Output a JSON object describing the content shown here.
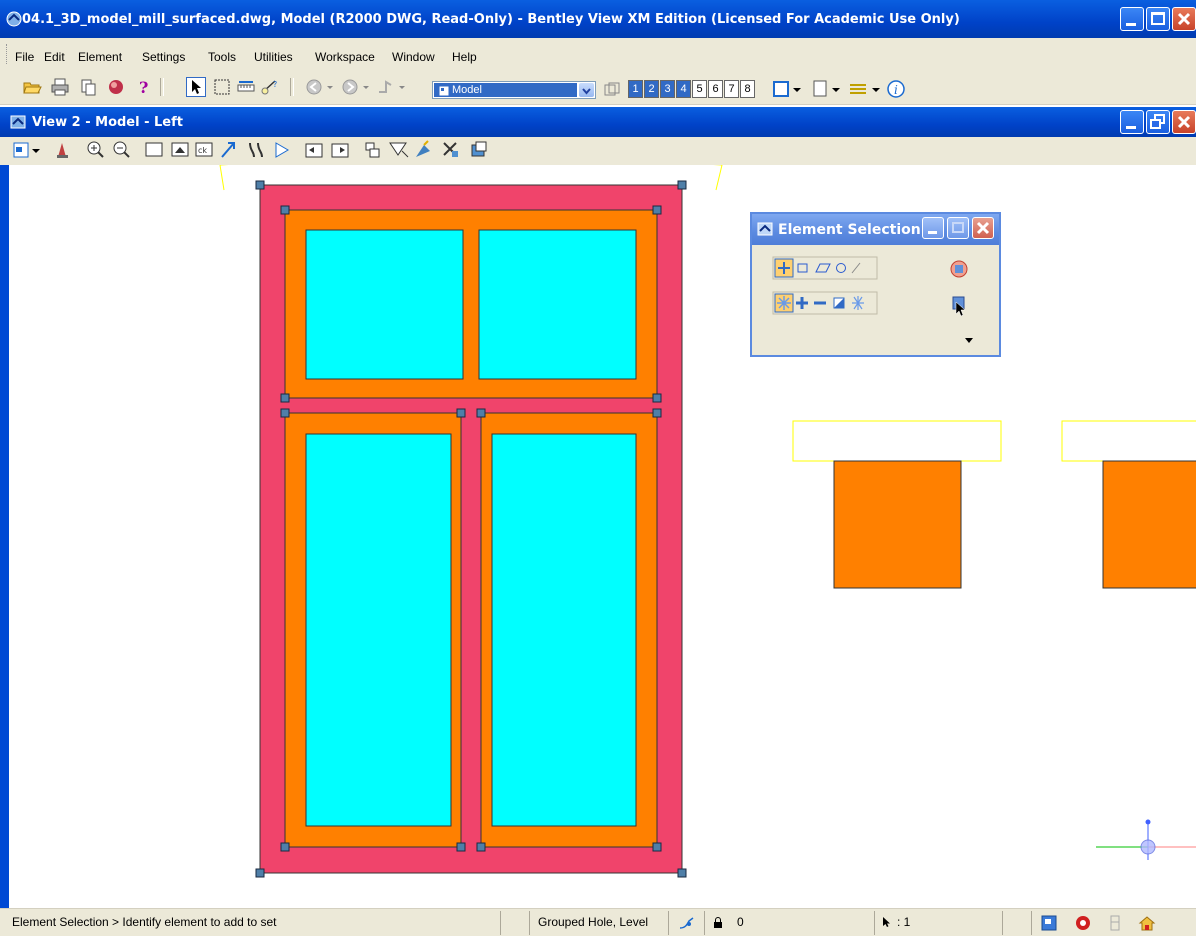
{
  "window": {
    "title": "04.1_3D_model_mill_surfaced.dwg, Model (R2000 DWG, Read-Only) - Bentley View XM Edition (Licensed For Academic Use Only)"
  },
  "menu": {
    "items": [
      "File",
      "Edit",
      "Element",
      "Settings",
      "Tools",
      "Utilities",
      "Workspace",
      "Window",
      "Help"
    ]
  },
  "toolbar": {
    "model_combo": "Model",
    "view_numbers": [
      "1",
      "2",
      "3",
      "4",
      "5",
      "6",
      "7",
      "8"
    ],
    "active_views": [
      "1",
      "2",
      "3",
      "4"
    ]
  },
  "view": {
    "title": "View 2 - Model - Left"
  },
  "dialog": {
    "title": "Element Selection"
  },
  "status": {
    "prompt": "Element Selection > Identify element to add to set",
    "element_info": "Grouped Hole, Level",
    "lock_value": "0",
    "selection_count": ": 1"
  },
  "colors": {
    "frame_outer": "#f0446b",
    "frame_inner": "#ff8000",
    "glass": "#00ffff",
    "handle": "#4f7fa8",
    "titlebar": "#0046d5",
    "faded_titlebar": "#6d96e6",
    "highlight": "#ffff00"
  }
}
